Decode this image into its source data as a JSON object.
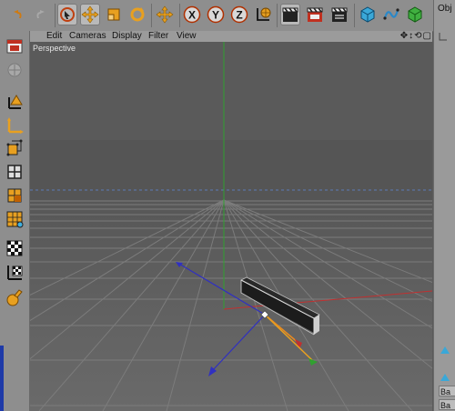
{
  "toolbar": {
    "buttons": [
      {
        "name": "undo-icon"
      },
      {
        "name": "redo-icon"
      },
      {
        "name": "live-selection-icon",
        "active": true
      },
      {
        "name": "move-icon",
        "active": true
      },
      {
        "name": "scale-icon"
      },
      {
        "name": "rotate-icon"
      },
      {
        "name": "world-move-icon"
      },
      {
        "name": "x-axis-lock-icon",
        "label": "X"
      },
      {
        "name": "y-axis-lock-icon",
        "label": "Y"
      },
      {
        "name": "z-axis-lock-icon",
        "label": "Z"
      },
      {
        "name": "coordinate-system-icon"
      },
      {
        "name": "render-view-icon"
      },
      {
        "name": "render-picture-viewer-icon"
      },
      {
        "name": "render-settings-icon"
      },
      {
        "name": "cube-object-icon"
      },
      {
        "name": "spline-icon"
      },
      {
        "name": "nurbs-icon"
      }
    ]
  },
  "left_toolbar": {
    "buttons": [
      {
        "name": "make-editable-icon"
      },
      {
        "name": "model-mode-icon"
      },
      {
        "name": "object-axis-icon"
      },
      {
        "name": "texture-axis-icon"
      },
      {
        "name": "points-mode-icon"
      },
      {
        "name": "edges-mode-icon"
      },
      {
        "name": "polygons-mode-icon"
      },
      {
        "name": "uvw-mode-icon"
      },
      {
        "name": "texture-mode-icon"
      },
      {
        "name": "workplane-icon"
      },
      {
        "name": "sculpt-icon"
      }
    ]
  },
  "menu": {
    "items": [
      "Edit",
      "Cameras",
      "Display",
      "Filter",
      "View"
    ],
    "nav_icons": "✥↕⟲▢"
  },
  "viewport": {
    "label": "Perspective",
    "colors": {
      "sky": "#595959",
      "floor": "#5f5f5f",
      "grid": "#7e7e7e",
      "x_axis": "#c03030",
      "y_axis": "#30a030",
      "z_axis": "#3030c0",
      "object_dark": "#1a1a1a",
      "object_light": "#bdbdbd"
    }
  },
  "right_panel": {
    "tab": "Obj",
    "fields": [
      "Ba",
      "Ba"
    ]
  }
}
